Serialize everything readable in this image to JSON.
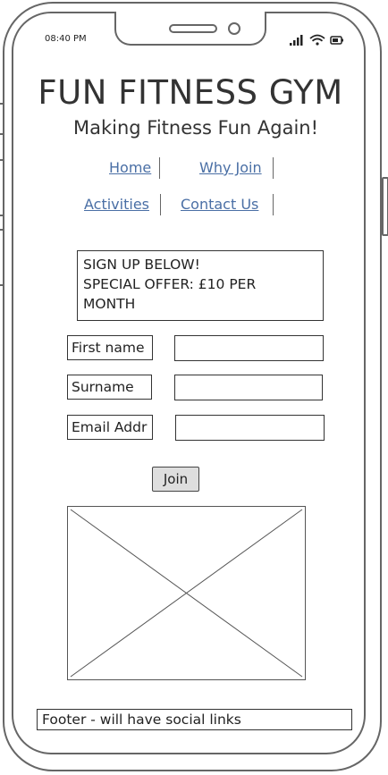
{
  "status_bar": {
    "time": "08:40 PM"
  },
  "header": {
    "title": "FUN FITNESS GYM",
    "subtitle": "Making Fitness Fun Again!"
  },
  "nav": {
    "items": [
      {
        "label": "Home"
      },
      {
        "label": "Why Join"
      },
      {
        "label": "Activities"
      },
      {
        "label": "Contact Us"
      }
    ]
  },
  "offer": {
    "line1": "SIGN UP BELOW!",
    "line2": "SPECIAL OFFER: £10 PER",
    "line3": "MONTH"
  },
  "form": {
    "first_name_label": "First name",
    "first_name_value": "",
    "surname_label": "Surname",
    "surname_value": "",
    "email_label": "Email Addr",
    "email_value": "",
    "join_label": "Join"
  },
  "footer": {
    "text": "Footer - will have social links"
  },
  "colors": {
    "link": "#4a6fa5",
    "outline": "#666666",
    "button_bg": "#dedede"
  },
  "icons": [
    "signal-icon",
    "wifi-icon",
    "battery-icon"
  ]
}
